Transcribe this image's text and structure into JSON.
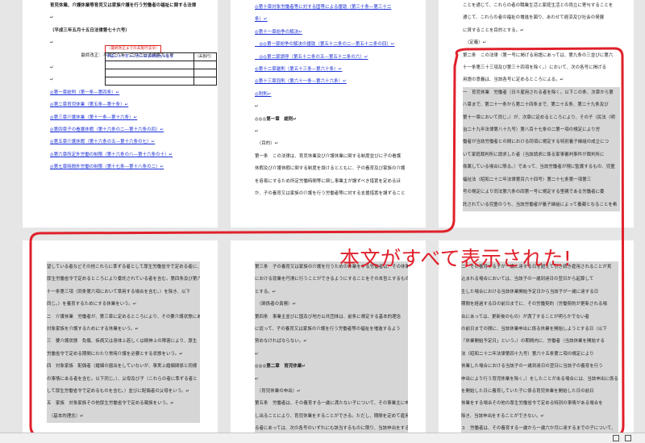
{
  "pages": {
    "p1": {
      "lines": [
        {
          "t": "育児休業、介護休業等育児又は家族介護を行う労働者の福祉に関する法律",
          "c": "bold"
        },
        {
          "t": "↵",
          "c": ""
        },
        {
          "t": "（平成三年五月十五日法律第七十六号）",
          "c": "bold"
        },
        {
          "t": "↵",
          "c": ""
        },
        {
          "t": "　　　　　　　最終改正：平成二八年一二月二日法律第九五号",
          "c": ""
        },
        {
          "t": "↵",
          "c": ""
        },
        {
          "t": "",
          "c": ""
        },
        {
          "t": "",
          "c": ""
        },
        {
          "t": "",
          "c": ""
        },
        {
          "t": "",
          "c": ""
        },
        {
          "t": "↵",
          "c": ""
        },
        {
          "t": "◎第一章総則（第一条―第四条）↵",
          "c": "link"
        },
        {
          "t": "◎第二章育児休業（第五条―第十条）↵",
          "c": "link"
        },
        {
          "t": "◎第三章介護休業（第十一条―第十六条）↵",
          "c": "link"
        },
        {
          "t": "◎第四章子の看護休暇（第十六条の二―第十六条の四）↵",
          "c": "link"
        },
        {
          "t": "◎第五章介護休暇（第十六条の五―第十六条の七）↵",
          "c": "link"
        },
        {
          "t": "◎第六章所定外労働の制限（第十六条の八―第十六条の十）↵",
          "c": "link"
        },
        {
          "t": "◎第七章時間外労働の制限（第十七条―第十八条の二）↵",
          "c": "link"
        }
      ],
      "revision_note": "（最終改正までの未施行法令）",
      "revision_table": [
        [
          "平成二十八年十二月二日法律第九十五号",
          "（未施行）"
        ],
        [
          "",
          ""
        ],
        [
          "",
          ""
        ],
        [
          "",
          ""
        ]
      ]
    },
    "p2": {
      "lines": [
        {
          "t": "◎第十章対象労働者等に対する国等による援助（第三十条―第三十二",
          "c": "link"
        },
        {
          "t": "条）↵",
          "c": "link"
        },
        {
          "t": "",
          "c": ""
        },
        {
          "t": "◎第十一章紛争の解決↵",
          "c": "link"
        },
        {
          "t": "　◎◎第一節紛争の解決の援助（第五十二条の二―第五十二条の四）↵",
          "c": "link"
        },
        {
          "t": "　◎◎第二節調停（第五十二条の五―第五十二条の六）↵",
          "c": "link"
        },
        {
          "t": "◎第十二章雑則（第五十三条―第六十条）↵",
          "c": "link"
        },
        {
          "t": "◎第十三章罰則（第六十一条―第六十六条）↵",
          "c": "link"
        },
        {
          "t": "◎附則↵",
          "c": "link"
        },
        {
          "t": "↵",
          "c": ""
        },
        {
          "t": "◎◎◎第一章　総則↵",
          "c": "bold"
        },
        {
          "t": "↵",
          "c": ""
        },
        {
          "t": "　（目的）↵",
          "c": ""
        },
        {
          "t": "第一条　この法律は、育児休業及び介護休業に関する制度並びに子の看護",
          "c": ""
        },
        {
          "t": "休暇及び介護休暇に関する制度を設けるとともに、子の養育及び家族の介護",
          "c": ""
        },
        {
          "t": "を容易にするため所定労働時間等に関し事業主が講ずべき措置を定めるほ",
          "c": ""
        },
        {
          "t": "か、子の養育又は家族の介護を行う労働者等に対する支援措置を講ずること",
          "c": ""
        }
      ]
    },
    "p3": {
      "lines": [
        {
          "t": "ことを通じて、これらの者の職業生活と家庭生活との両立に寄与することを",
          "c": ""
        },
        {
          "t": "通じて、これらの者の福祉の増進を図り、あわせて経済及び社会の発展",
          "c": ""
        },
        {
          "t": "に資することを目的とする。↵",
          "c": ""
        },
        {
          "t": "　（定義）↵",
          "c": ""
        },
        {
          "t": "第二条　この法律（第一号に掲げる用語にあっては、第九条の三並びに第六",
          "c": ""
        },
        {
          "t": "十一条第三十三項及び第三十四項を除く。）において、次の各号に掲げる",
          "c": ""
        },
        {
          "t": "用語の意義は、当該各号に定めるところによる。↵",
          "c": ""
        },
        {
          "t": "一　育児休業　労働者（日々雇用される者を除く。以下この条、次章から第",
          "c": "gray"
        },
        {
          "t": "八章まで、第二十一条から第二十四条まで、第二十五条、第二十九条及び",
          "c": "gray"
        },
        {
          "t": "第十一章において同じ。）が、次章に定めるところにより、その子（民法（明",
          "c": "gray"
        },
        {
          "t": "治二十九年法律第八十九号）第八百十七条の二第一項の規定により労",
          "c": "gray"
        },
        {
          "t": "働者が当該労働者との間における同項に規定する特別養子縁組の成立につ",
          "c": "gray"
        },
        {
          "t": "いて家庭裁判所に請求した者（当該請求に係る家事審判事件が裁判所に",
          "c": "gray"
        },
        {
          "t": "係属している場合に限る。）であって、当該労働者が現に監護するもの、児童",
          "c": "gray"
        },
        {
          "t": "福祉法（昭和二十二年法律第百六十四号）第二十七条第一項第三",
          "c": "gray"
        },
        {
          "t": "号の規定により同法第六条の四第一号に規定する里親である労働者に委",
          "c": "gray"
        },
        {
          "t": "託されている児童のうち、当該労働者が養子縁組によって養親となることを希",
          "c": "gray"
        }
      ]
    },
    "p4": {
      "lines": [
        {
          "t": "望している者などその他これらに準ずる者として厚生労働省令で定める者に、",
          "c": "gray"
        },
        {
          "t": "厚生労働省令で定めるところにより委託されている者を含む。第四条及び第六",
          "c": "gray"
        },
        {
          "t": "十一条第三項（同条第六項において準用する場合を含む。）を除き、以下",
          "c": "gray"
        },
        {
          "t": "同じ。）を養育するためにする休業をいう。↵",
          "c": "gray"
        },
        {
          "t": "二　介護休業　労働者が、第三章に定めるところにより、その要介護状態にある",
          "c": "gray"
        },
        {
          "t": "対象家族を介護するためにする休業をいう。↵",
          "c": "gray"
        },
        {
          "t": "三　要介護状態　負傷、疾病又は身体上若しくは精神上の障害により、厚生",
          "c": "gray"
        },
        {
          "t": "労働省令で定める期間にわたり常時介護を必要とする状態をいう。↵",
          "c": "gray"
        },
        {
          "t": "四　対象家族　配偶者（婚姻の届出をしていないが、事実上婚姻関係と同様",
          "c": "gray"
        },
        {
          "t": "の事情にある者を含む。以下同じ。）、父母及び子（これらの者に準ずる者と",
          "c": "gray"
        },
        {
          "t": "して厚生労働省令で定めるものを含む。）並びに配偶者の父母をいう。↵",
          "c": "gray"
        },
        {
          "t": "五　家族　対象家族その他厚生労働省令で定める親族をいう。↵",
          "c": "gray"
        },
        {
          "t": "　（基本的理念）↵",
          "c": "gray"
        }
      ]
    },
    "p5": {
      "lines": [
        {
          "t": "第三条　子の養育又は家族の介護を行うための休業をする労働者は、その休業後",
          "c": "gray"
        },
        {
          "t": "における就業を円滑に行うことができるようにすることをその本旨とするもの",
          "c": "gray"
        },
        {
          "t": "とする。↵",
          "c": "gray"
        },
        {
          "t": "　（関係者の責務）↵",
          "c": "gray"
        },
        {
          "t": "第四条　事業主並びに国及び地方公共団体は、前条に規定する基本的理念",
          "c": "gray"
        },
        {
          "t": "に従って、子の養育又は家族の介護を行う労働者等の福祉を増進するよう",
          "c": "gray"
        },
        {
          "t": "努めなければならない。↵",
          "c": "gray"
        },
        {
          "t": "↵",
          "c": "gray"
        },
        {
          "t": "◎◎◎第二章　育児休業↵",
          "c": "gray bold"
        },
        {
          "t": "↵",
          "c": "gray"
        },
        {
          "t": "　（育児休業の申出）↵",
          "c": "gray"
        },
        {
          "t": "第五条　労働者は、その養育する一歳に満たない子について、その事業主に申",
          "c": "gray"
        },
        {
          "t": "し出ることにより、育児休業をすることができる。ただし、期間を定めて雇用され",
          "c": "gray"
        },
        {
          "t": "る者にあっては、次の各号のいずれにも該当するものに限り、当該申出をする",
          "c": "gray"
        }
      ]
    },
    "p6": {
      "lines": [
        {
          "t": "二　その養育する子が一歳に達する日を超えて引き続き雇用されることが見",
          "c": "gray"
        },
        {
          "t": "込まれる場合においては、当該子の一歳到達日の翌日から起算して",
          "c": "gray"
        },
        {
          "t": "生した場合における当該休業開始予定日から当該子が一歳に達する日",
          "c": "gray"
        },
        {
          "t": "期間を経過する日の前日までに、その労働契約（労働契約が更新される場",
          "c": "gray"
        },
        {
          "t": "合にあっては、更新後のもの）が満了することが明らかでない者",
          "c": "gray"
        },
        {
          "t": "の前日までの間に、当該休業申出に係る休業を開始しようとする日（以下",
          "c": "gray"
        },
        {
          "t": "「休業開始予定日」という。）の期間内に、労働者（当該休業を開始する",
          "c": "gray"
        },
        {
          "t": "法（昭和二十二年法律第四十九号）第六十五条第二項の規定により",
          "c": "gray"
        },
        {
          "t": "休業した場合における当該子の一歳到達日の翌日に当該子の養育を行う",
          "c": "gray"
        },
        {
          "t": "申出により行う育児休業を除く。）をしたことがある場合には、当該申出に係る",
          "c": "gray"
        },
        {
          "t": "を開始した日に養育していた子に係る育児休業を開始した日の前日",
          "c": "gray"
        },
        {
          "t": "休業をする場合その他の厚生労働省令で定める特別の事情がある場合を",
          "c": "gray"
        },
        {
          "t": "除き、当該申出をすることができない。↵",
          "c": "gray"
        },
        {
          "t": "３　労働者は、その養育する一歳から一歳六か月に達するまでの子について、",
          "c": "gray"
        },
        {
          "t": "次の各号のいずれにも該当する場合に限り、その事業主に申し出ることにより",
          "c": "gray"
        }
      ]
    }
  },
  "annotation_text": "本文がすべて表示された!",
  "colors": {
    "annotation": "#e0202a",
    "link": "#1a2fd6",
    "highlight": "#d6d6d6"
  }
}
